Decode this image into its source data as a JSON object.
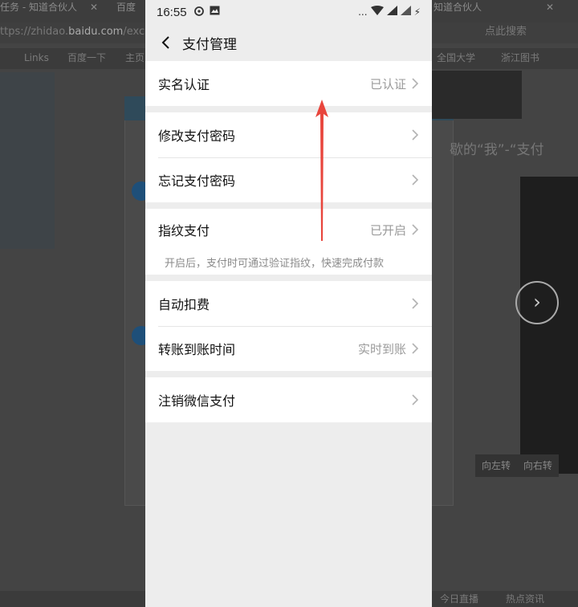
{
  "background": {
    "tab1": "任务 - 知道合伙人",
    "tab2": "百度",
    "tab3": "知道合伙人",
    "url_prefix": "ttps://zhidao.",
    "url_domain": "baidu.com",
    "url_suffix": "/exc",
    "search_hint": "点此搜索",
    "bookmarks": [
      "Links",
      "百度一下",
      "主页",
      "全国大学",
      "浙江图书"
    ],
    "right_text": "歇的“我”-“支付",
    "rotate_left": "向左转",
    "rotate_right": "向右转",
    "bottom_a": "今日直播",
    "bottom_b": "热点资讯"
  },
  "status": {
    "time": "16:55",
    "dots": "...",
    "charge": "⚡"
  },
  "nav": {
    "title": "支付管理"
  },
  "groups": [
    {
      "items": [
        {
          "label": "实名认证",
          "value": "已认证"
        }
      ]
    },
    {
      "items": [
        {
          "label": "修改支付密码"
        },
        {
          "label": "忘记支付密码"
        }
      ]
    },
    {
      "items": [
        {
          "label": "指纹支付",
          "value": "已开启",
          "desc": "开启后，支付时可通过验证指纹，快速完成付款"
        }
      ]
    },
    {
      "items": [
        {
          "label": "自动扣费"
        },
        {
          "label": "转账到账时间",
          "value": "实时到账"
        }
      ]
    },
    {
      "items": [
        {
          "label": "注销微信支付"
        }
      ]
    }
  ],
  "colors": {
    "accent_arrow": "#e8453c",
    "wechat_green": "#11c36b"
  }
}
